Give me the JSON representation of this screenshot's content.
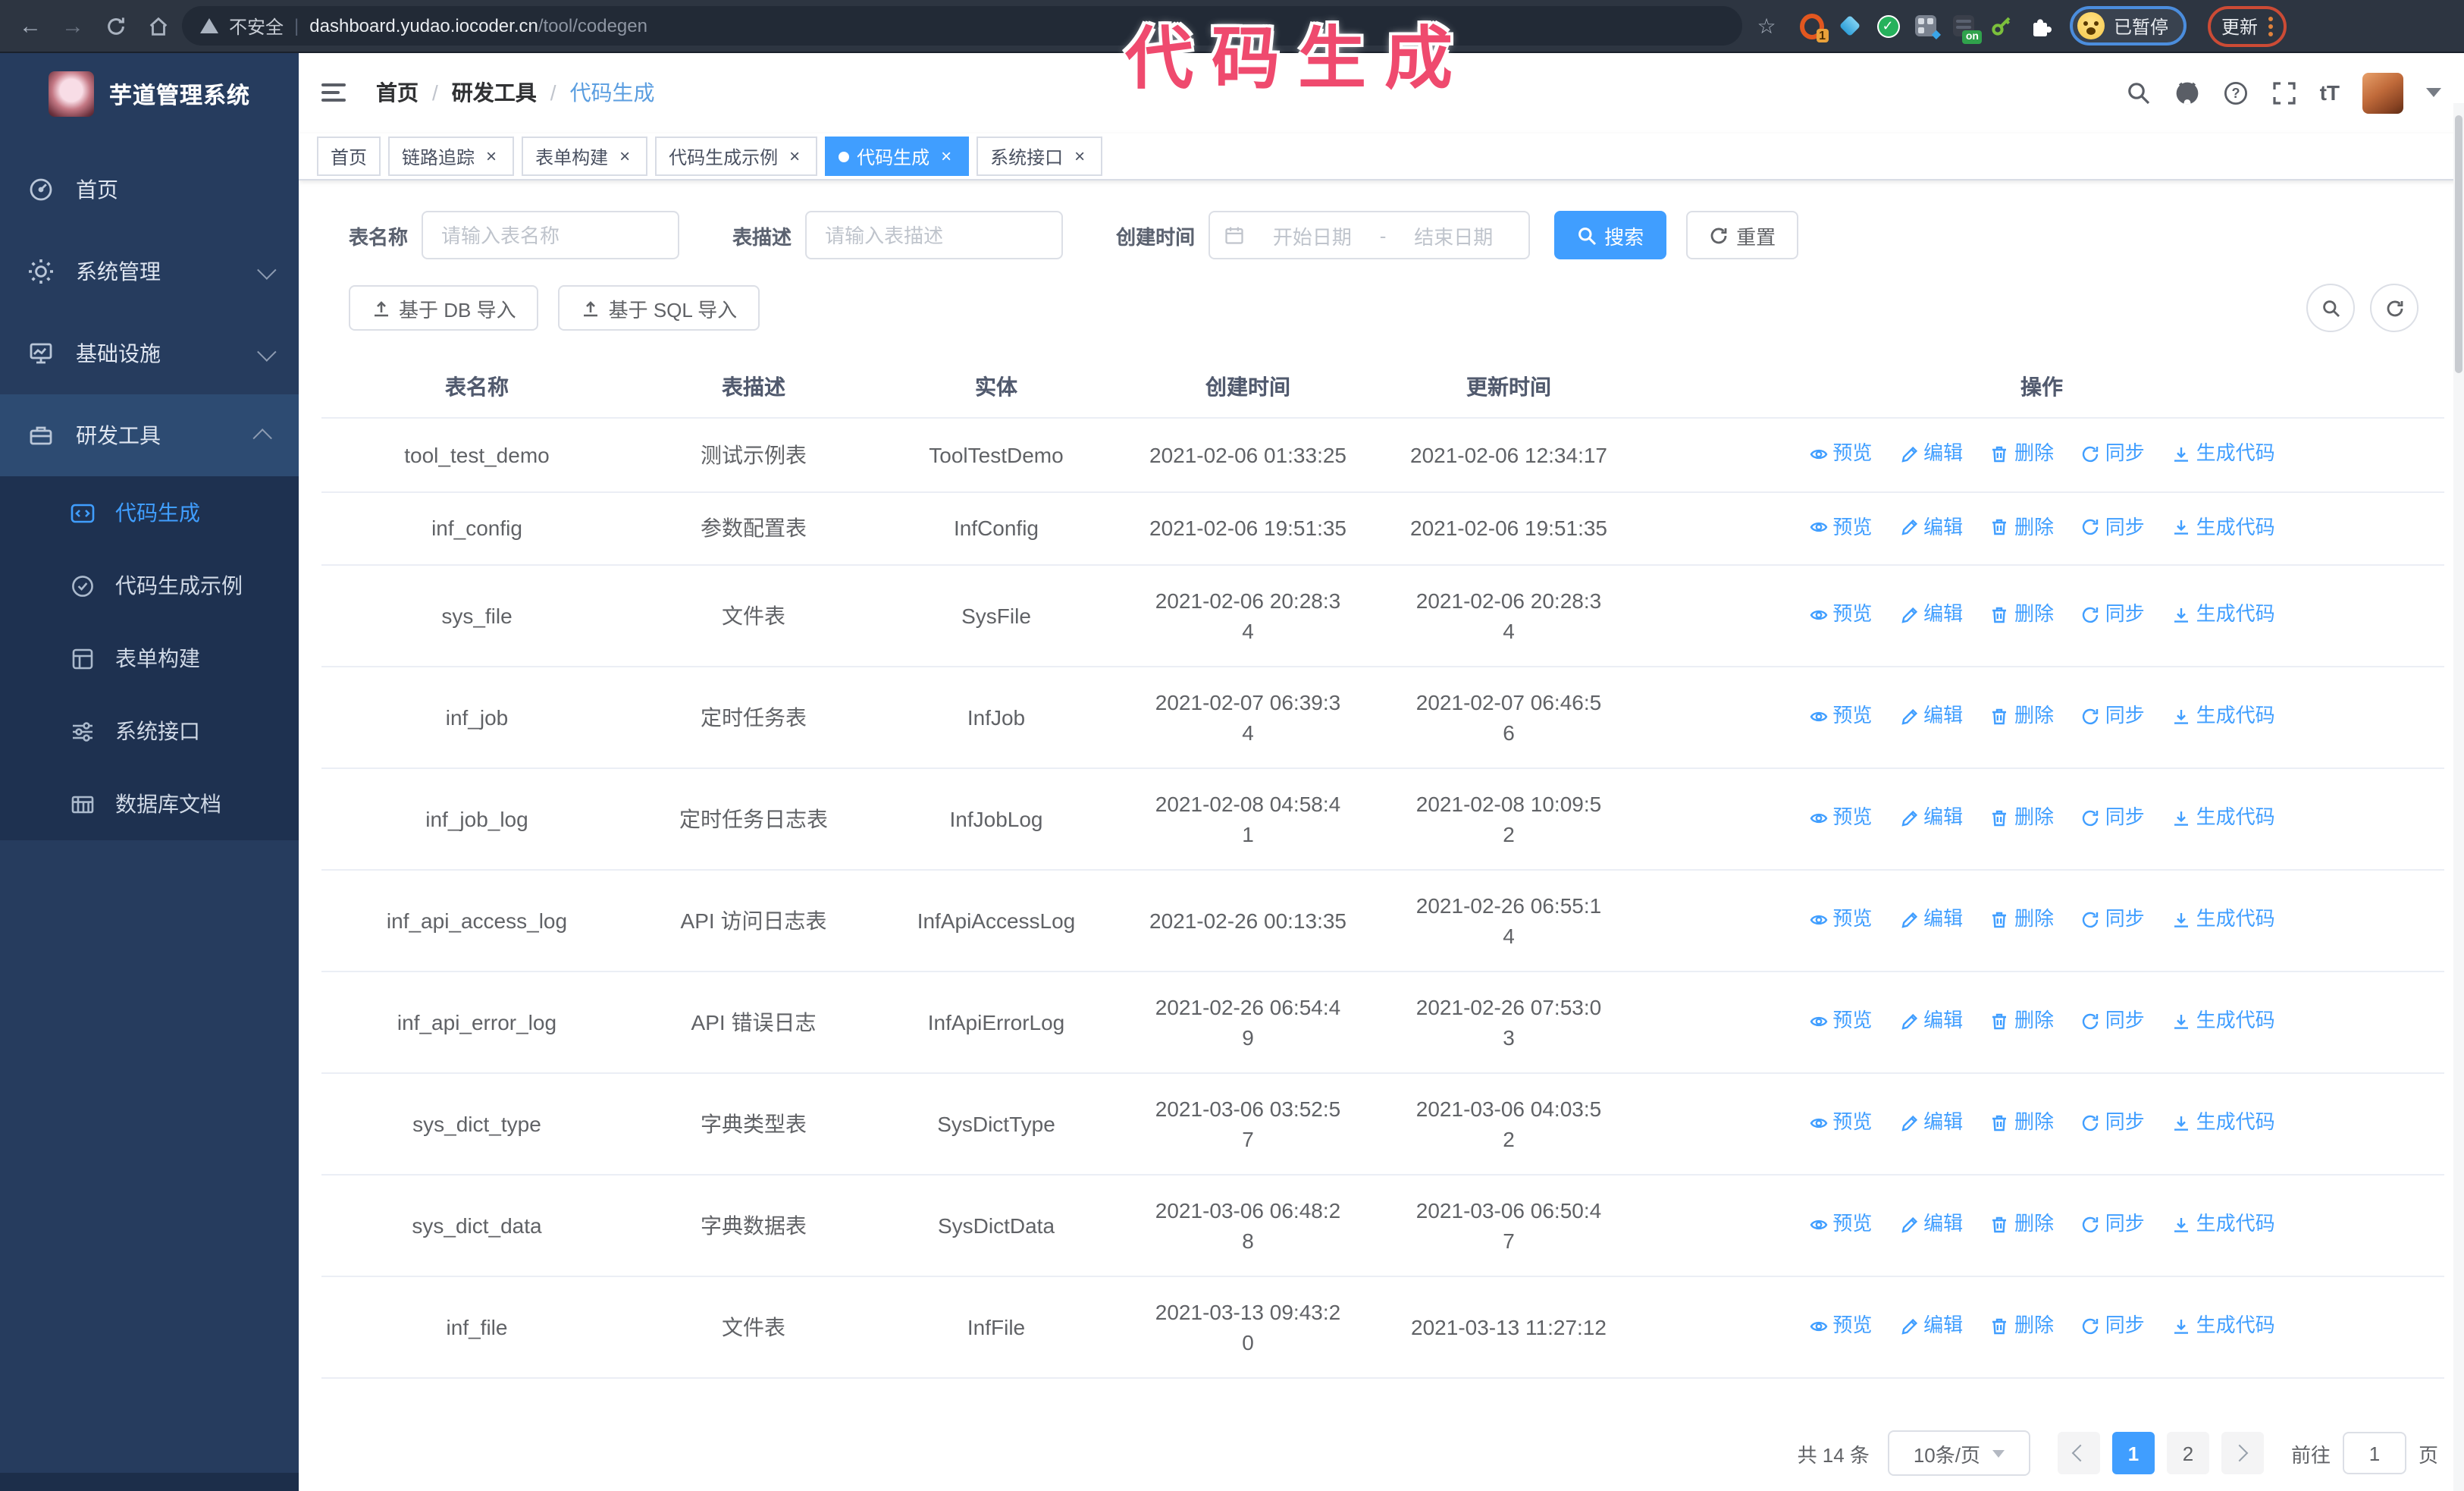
{
  "colors": {
    "accent": "#409eff",
    "watermark_pink": "#ef4a6e",
    "sidebar_bg": "#263c5e",
    "toolbar_bg": "#2d3541"
  },
  "browser": {
    "insecure_label": "不安全",
    "url_domain": "dashboard.yudao.iocoder.cn",
    "url_path": "/tool/codegen",
    "ext_badge_1": "1",
    "ext_badge_on": "on",
    "paused_badge": "已暂停",
    "update_label": "更新"
  },
  "watermark": {
    "text": "代码生成"
  },
  "sidebar": {
    "title": "芋道管理系统",
    "items": [
      {
        "label": "首页",
        "icon": "dashboard-icon"
      },
      {
        "label": "系统管理",
        "icon": "gear-icon"
      },
      {
        "label": "基础设施",
        "icon": "monitor-icon"
      },
      {
        "label": "研发工具",
        "icon": "toolbox-icon"
      }
    ],
    "submenu": [
      {
        "label": "代码生成",
        "icon": "code-icon",
        "active": true
      },
      {
        "label": "代码生成示例",
        "icon": "badge-check-icon"
      },
      {
        "label": "表单构建",
        "icon": "form-icon"
      },
      {
        "label": "系统接口",
        "icon": "sliders-icon"
      },
      {
        "label": "数据库文档",
        "icon": "database-doc-icon"
      }
    ]
  },
  "header": {
    "breadcrumb": [
      "首页",
      "研发工具",
      "代码生成"
    ],
    "separator": "/",
    "font_icon_text": "tT",
    "help_glyph": "?"
  },
  "tabs": [
    {
      "label": "首页"
    },
    {
      "label": "链路追踪"
    },
    {
      "label": "表单构建"
    },
    {
      "label": "代码生成示例"
    },
    {
      "label": "代码生成"
    },
    {
      "label": "系统接口"
    }
  ],
  "filters": {
    "name_label": "表名称",
    "name_placeholder": "请输入表名称",
    "desc_label": "表描述",
    "desc_placeholder": "请输入表描述",
    "time_label": "创建时间",
    "start_placeholder": "开始日期",
    "range_separator": "-",
    "end_placeholder": "结束日期",
    "search_label": "搜索",
    "reset_label": "重置"
  },
  "toolbar": {
    "import_db_label": "基于 DB 导入",
    "import_sql_label": "基于 SQL 导入"
  },
  "table": {
    "columns": [
      "表名称",
      "表描述",
      "实体",
      "创建时间",
      "更新时间",
      "操作"
    ],
    "actions": [
      "预览",
      "编辑",
      "删除",
      "同步",
      "生成代码"
    ],
    "rows": [
      {
        "name": "tool_test_demo",
        "desc": "测试示例表",
        "entity": "ToolTestDemo",
        "create": "2021-02-06 01:33:25",
        "update": "2021-02-06 12:34:17"
      },
      {
        "name": "inf_config",
        "desc": "参数配置表",
        "entity": "InfConfig",
        "create": "2021-02-06 19:51:35",
        "update": "2021-02-06 19:51:35"
      },
      {
        "name": "sys_file",
        "desc": "文件表",
        "entity": "SysFile",
        "create": "2021-02-06 20:28:3\n4",
        "update": "2021-02-06 20:28:3\n4"
      },
      {
        "name": "inf_job",
        "desc": "定时任务表",
        "entity": "InfJob",
        "create": "2021-02-07 06:39:3\n4",
        "update": "2021-02-07 06:46:5\n6"
      },
      {
        "name": "inf_job_log",
        "desc": "定时任务日志表",
        "entity": "InfJobLog",
        "create": "2021-02-08 04:58:4\n1",
        "update": "2021-02-08 10:09:5\n2"
      },
      {
        "name": "inf_api_access_log",
        "desc": "API 访问日志表",
        "entity": "InfApiAccessLog",
        "create": "2021-02-26 00:13:35",
        "update": "2021-02-26 06:55:1\n4"
      },
      {
        "name": "inf_api_error_log",
        "desc": "API 错误日志",
        "entity": "InfApiErrorLog",
        "create": "2021-02-26 06:54:4\n9",
        "update": "2021-02-26 07:53:0\n3"
      },
      {
        "name": "sys_dict_type",
        "desc": "字典类型表",
        "entity": "SysDictType",
        "create": "2021-03-06 03:52:5\n7",
        "update": "2021-03-06 04:03:5\n2"
      },
      {
        "name": "sys_dict_data",
        "desc": "字典数据表",
        "entity": "SysDictData",
        "create": "2021-03-06 06:48:2\n8",
        "update": "2021-03-06 06:50:4\n7"
      },
      {
        "name": "inf_file",
        "desc": "文件表",
        "entity": "InfFile",
        "create": "2021-03-13 09:43:2\n0",
        "update": "2021-03-13 11:27:12"
      }
    ]
  },
  "pagination": {
    "total_text": "共 14 条",
    "page_size": "10条/页",
    "pages": [
      "1",
      "2"
    ],
    "current_page": "1",
    "goto_label": "前往",
    "goto_value": "1",
    "page_unit": "页"
  }
}
